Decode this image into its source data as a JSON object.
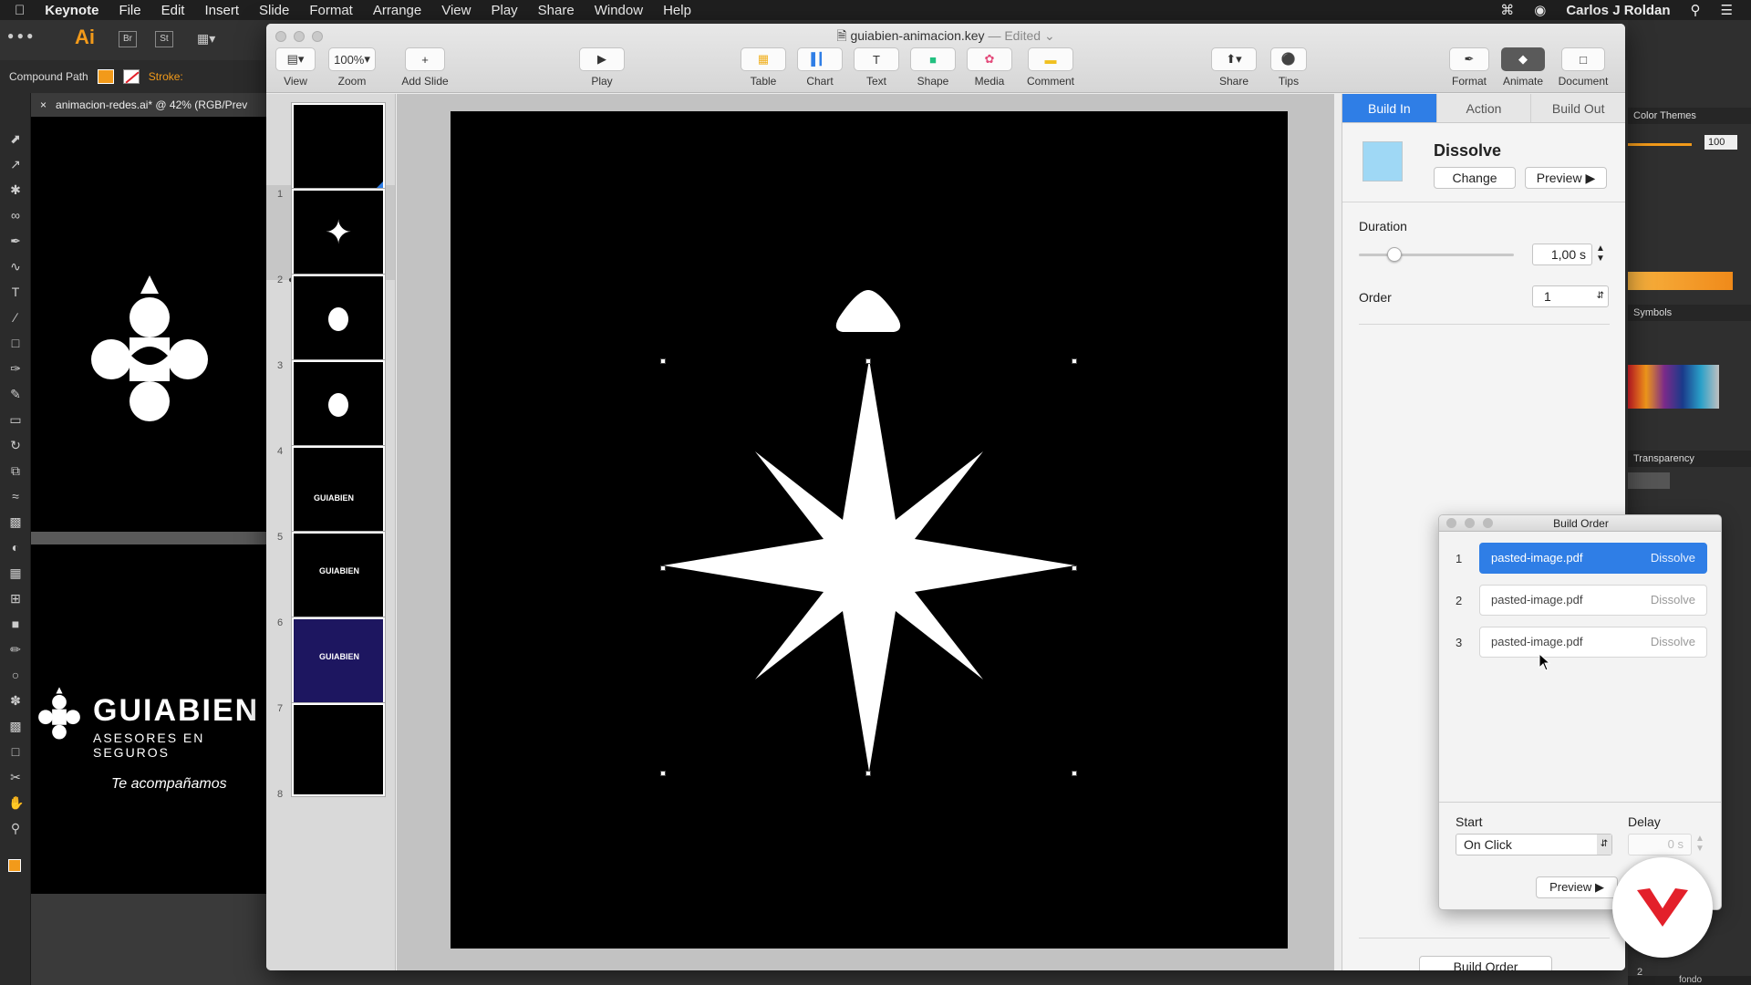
{
  "menubar": {
    "app": "Keynote",
    "items": [
      "File",
      "Edit",
      "Insert",
      "Slide",
      "Format",
      "Arrange",
      "View",
      "Play",
      "Share",
      "Window",
      "Help"
    ],
    "user": "Carlos J Roldan"
  },
  "illustrator": {
    "option_label": "Compound Path",
    "stroke_label": "Stroke:",
    "doc_tab": "animacion-redes.ai* @ 42% (RGB/Prev",
    "brand_name": "GUIABIEN",
    "brand_sub": "ASESORES EN SEGUROS",
    "brand_tag": "Te acompañamos",
    "panel_color_themes": "Color Themes",
    "panel_opacity": "100",
    "panel_symbols": "Symbols",
    "panel_transparency": "Transparency",
    "layer_name": "fondo",
    "layer_count": "2"
  },
  "keynote": {
    "title": "guiabien-animacion.key",
    "title_suffix": "— Edited",
    "toolbar": {
      "view": "View",
      "zoom": "Zoom",
      "zoom_value": "100%",
      "add_slide": "Add Slide",
      "play": "Play",
      "table": "Table",
      "chart": "Chart",
      "text": "Text",
      "shape": "Shape",
      "media": "Media",
      "comment": "Comment",
      "share": "Share",
      "tips": "Tips",
      "format": "Format",
      "animate": "Animate",
      "document": "Document"
    },
    "slides": [
      "1",
      "2",
      "3",
      "4",
      "5",
      "6",
      "7",
      "8"
    ],
    "inspector": {
      "tabs": [
        "Build In",
        "Action",
        "Build Out"
      ],
      "effect": "Dissolve",
      "change": "Change",
      "preview": "Preview",
      "duration_label": "Duration",
      "duration_value": "1,00 s",
      "duration_fraction": 0.2,
      "order_label": "Order",
      "order_value": "1",
      "build_order_button": "Build Order"
    },
    "build_order": {
      "title": "Build Order",
      "rows": [
        {
          "num": "1",
          "name": "pasted-image.pdf",
          "effect": "Dissolve"
        },
        {
          "num": "2",
          "name": "pasted-image.pdf",
          "effect": "Dissolve"
        },
        {
          "num": "3",
          "name": "pasted-image.pdf",
          "effect": "Dissolve"
        }
      ],
      "start_label": "Start",
      "start_value": "On Click",
      "delay_label": "Delay",
      "delay_value": "0 s",
      "preview": "Preview"
    }
  },
  "colors": {
    "accent": "#2f7ee6",
    "dissolve_swatch": "#9fd8f5",
    "badge_red": "#e3202a"
  }
}
